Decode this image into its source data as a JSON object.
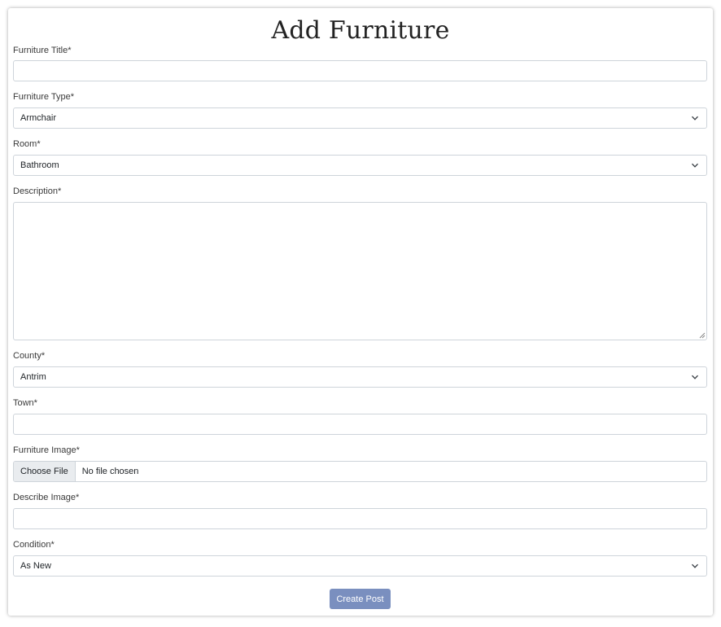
{
  "page": {
    "title": "Add Furniture"
  },
  "form": {
    "title_label": "Furniture Title*",
    "title_value": "",
    "type_label": "Furniture Type*",
    "type_selected": "Armchair",
    "room_label": "Room*",
    "room_selected": "Bathroom",
    "description_label": "Description*",
    "description_value": "",
    "county_label": "County*",
    "county_selected": "Antrim",
    "town_label": "Town*",
    "town_value": "",
    "image_label": "Furniture Image*",
    "image_button": "Choose File",
    "image_status": "No file chosen",
    "describe_label": "Describe Image*",
    "describe_value": "",
    "condition_label": "Condition*",
    "condition_selected": "As New",
    "submit_label": "Create Post"
  },
  "colors": {
    "button": "#7a8fbf",
    "border": "#ced4da",
    "file_button_bg": "#e9ecef"
  },
  "icons": {
    "select_arrow": "chevron-down-icon",
    "resize_handle": "resize-grip-icon"
  }
}
